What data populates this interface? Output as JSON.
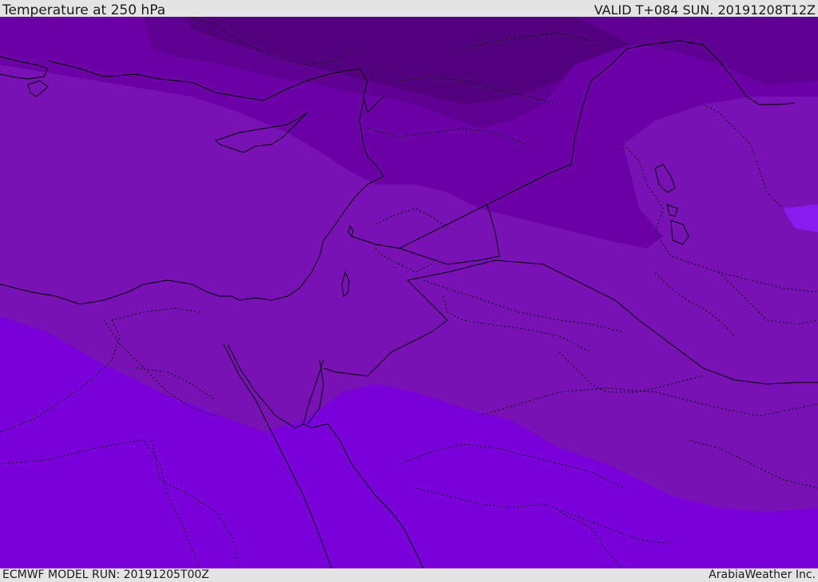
{
  "header": {
    "title": "Temperature at 250 hPa",
    "valid_time": "VALID T+084 SUN. 20191208T12Z"
  },
  "footer": {
    "model_run": "ECMWF MODEL RUN: 20191205T00Z",
    "credit": "ArabiaWeather Inc."
  },
  "map": {
    "field": "Temperature at 250 hPa",
    "colors": {
      "band_darkest": "#53007f",
      "band_dark": "#5f0092",
      "band_mid": "#6b00a6",
      "band_upper_mid": "#7812b5",
      "band_lower_mid": "#6e10a9",
      "band_light": "#7a00d9",
      "accent_patch": "#8a1cf0",
      "coastline": "#000000"
    }
  }
}
